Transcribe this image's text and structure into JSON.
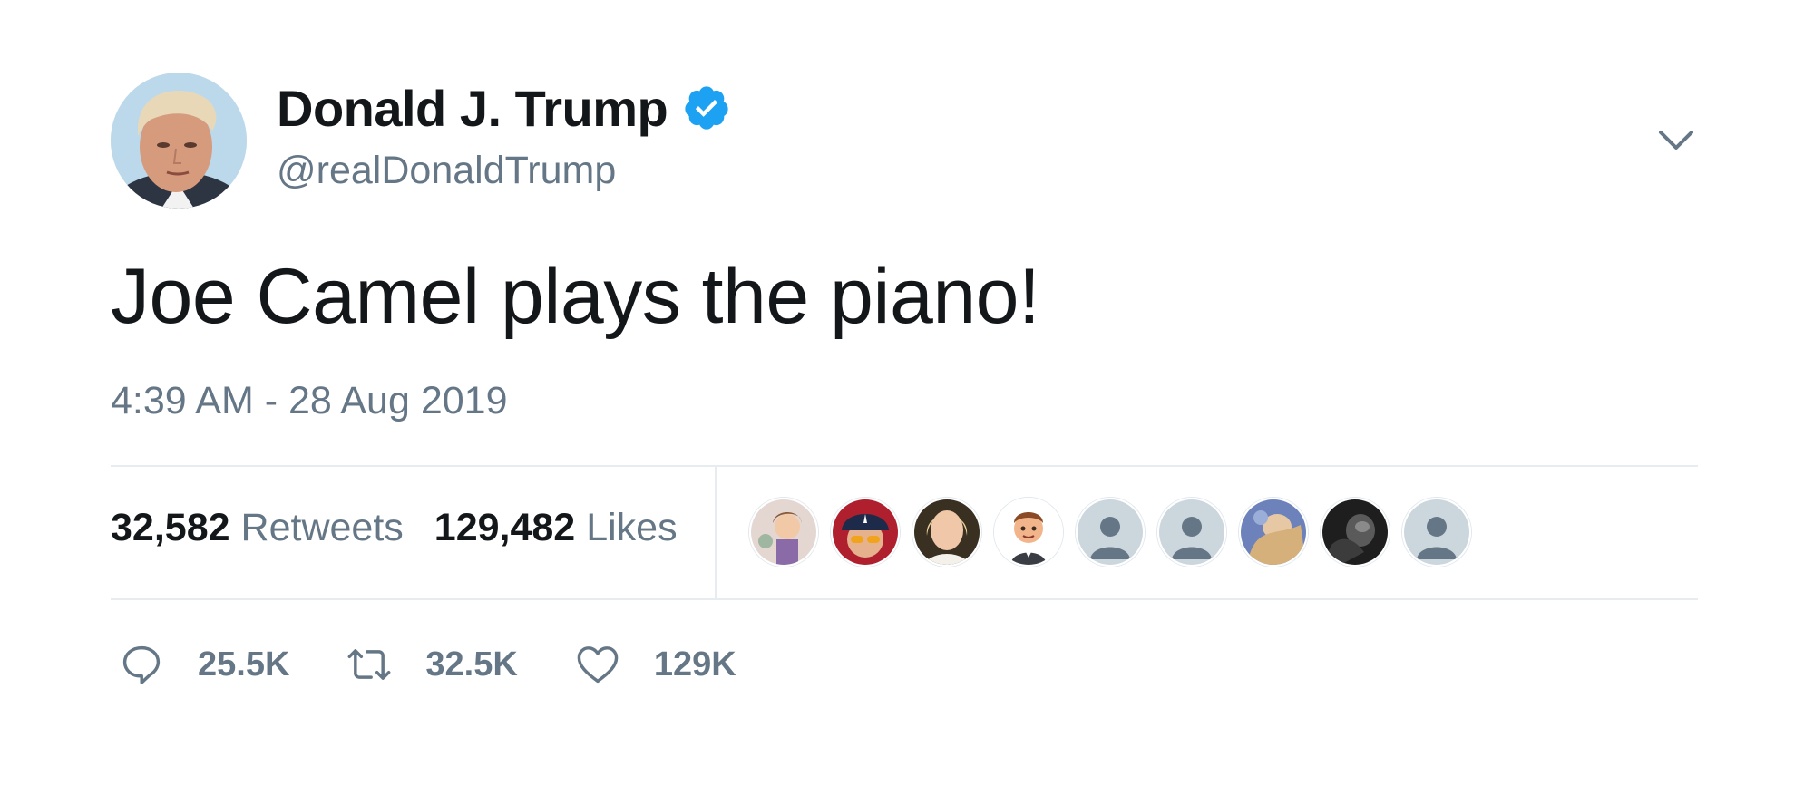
{
  "author": {
    "display_name": "Donald J. Trump",
    "handle": "@realDonaldTrump",
    "verified": true,
    "avatar_icon": "profile-photo",
    "verified_icon": "verified-badge-icon"
  },
  "tweet": {
    "text": "Joe Camel plays the piano!",
    "timestamp": "4:39 AM - 28 Aug 2019"
  },
  "stats": {
    "retweets_count": "32,582",
    "retweets_label": "Retweets",
    "likes_count": "129,482",
    "likes_label": "Likes"
  },
  "likers": [
    {
      "icon": "liker-avatar-illustration",
      "color": "#d9c7c2"
    },
    {
      "icon": "liker-avatar-cap",
      "color": "#2b2f4a"
    },
    {
      "icon": "liker-avatar-woman",
      "color": "#4a3b2c"
    },
    {
      "icon": "liker-avatar-cartoon",
      "color": "#ffffff"
    },
    {
      "icon": "default-avatar-icon",
      "color": "#ccd6dd"
    },
    {
      "icon": "default-avatar-icon",
      "color": "#ccd6dd"
    },
    {
      "icon": "liker-avatar-photo",
      "color": "#6b7fb5"
    },
    {
      "icon": "liker-avatar-dark",
      "color": "#2a2a2a"
    },
    {
      "icon": "default-avatar-icon",
      "color": "#ccd6dd"
    }
  ],
  "actions": {
    "reply_count": "25.5K",
    "retweet_count": "32.5K",
    "like_count": "129K"
  },
  "colors": {
    "text_primary": "#14171a",
    "text_secondary": "#657786",
    "verified_blue": "#1da1f2",
    "divider": "#e6ecf0"
  }
}
